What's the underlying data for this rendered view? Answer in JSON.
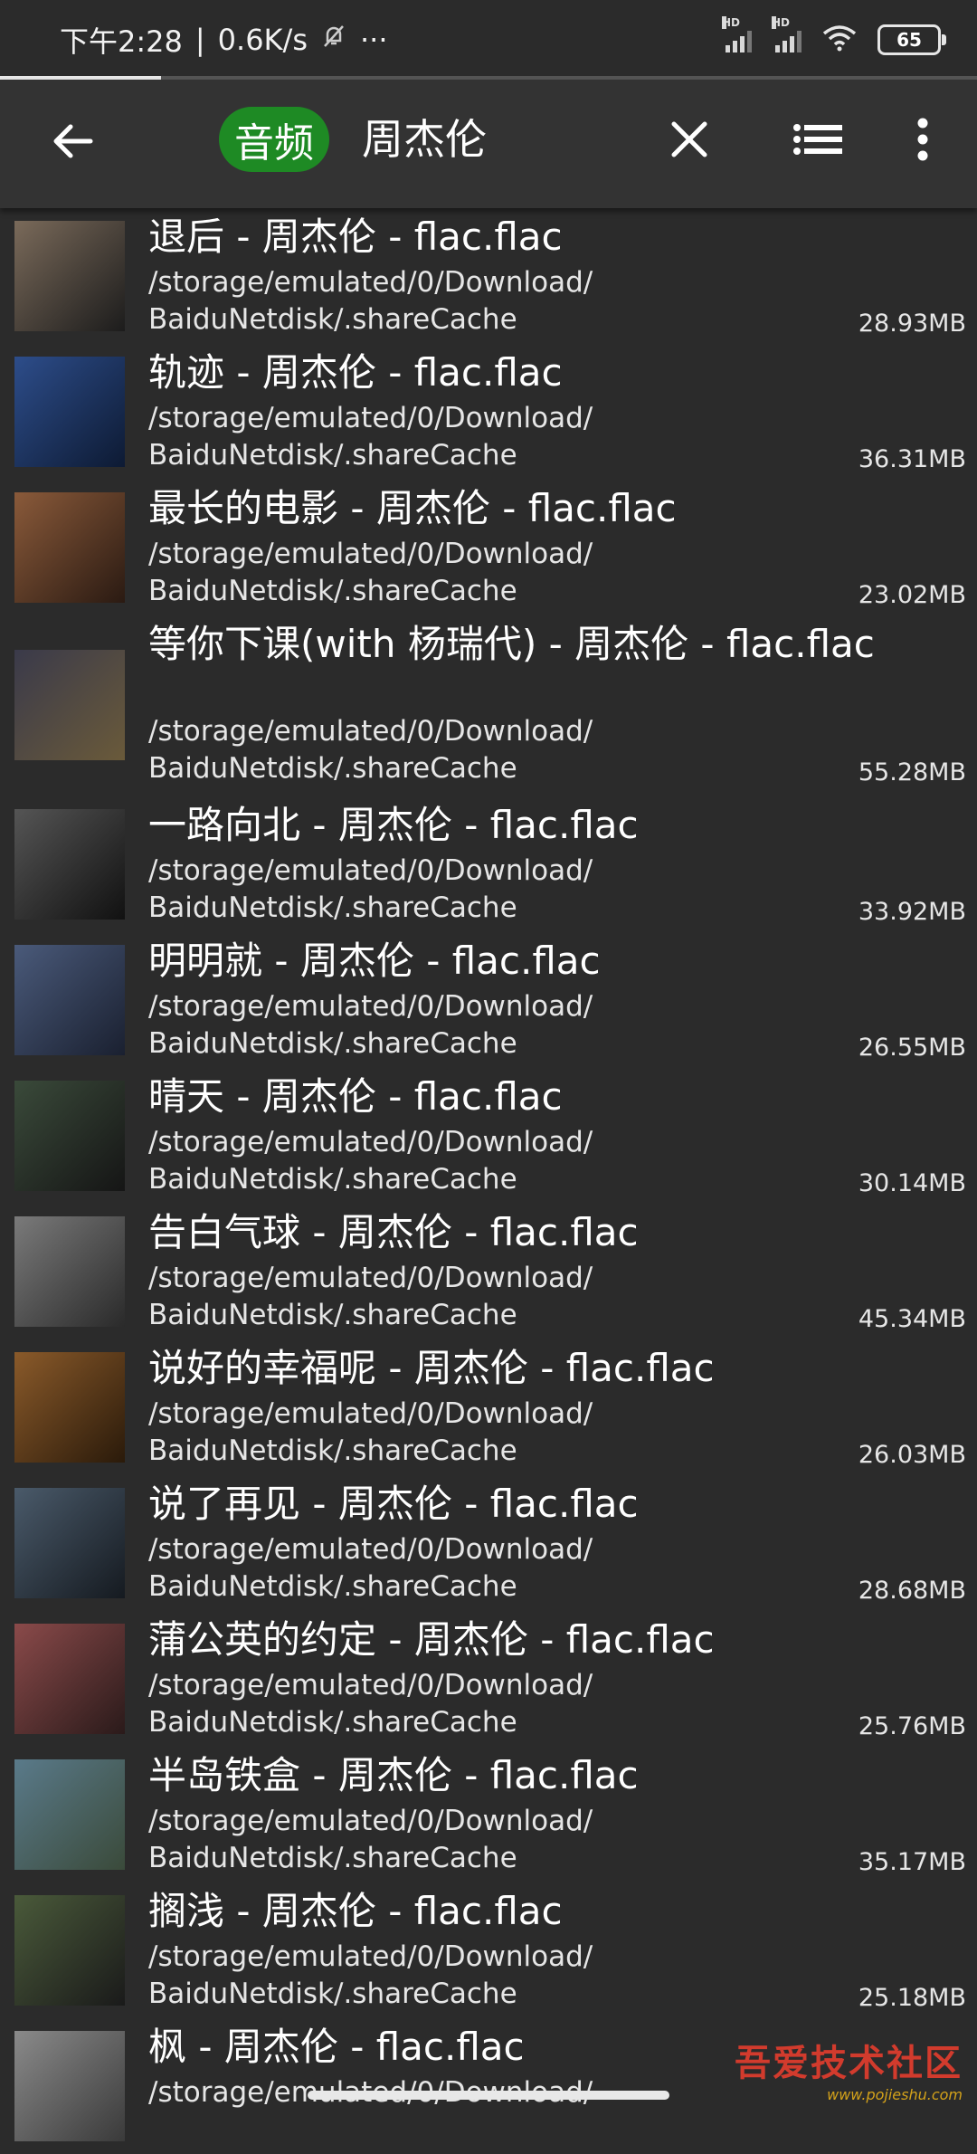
{
  "status_bar": {
    "time": "下午2:28",
    "separator": "|",
    "net_speed": "0.6K/s",
    "dnd_icon": "mute-bell-icon",
    "more_dots": "···",
    "signal1_label": "HD",
    "signal2_label": "HD",
    "wifi_icon": "wifi-icon",
    "battery": "65"
  },
  "progress": 0.165,
  "app_bar": {
    "back_icon": "arrow-left-icon",
    "filter_chip": "音频",
    "query": "周杰伦",
    "clear_icon": "close-icon",
    "view_icon": "list-view-icon",
    "more_icon": "more-vertical-icon"
  },
  "files": [
    {
      "title": "退后 - 周杰伦 - flac.flac",
      "path1": "/storage/emulated/0/Download/",
      "path2": "BaiduNetdisk/.shareCache",
      "size": "28.93MB"
    },
    {
      "title": "轨迹 - 周杰伦 - flac.flac",
      "path1": "/storage/emulated/0/Download/",
      "path2": "BaiduNetdisk/.shareCache",
      "size": "36.31MB"
    },
    {
      "title": "最长的电影 - 周杰伦 - flac.flac",
      "path1": "/storage/emulated/0/Download/",
      "path2": "BaiduNetdisk/.shareCache",
      "size": "23.02MB"
    },
    {
      "title": "等你下课(with 杨瑞代) - 周杰伦 - flac.flac",
      "path1": "/storage/emulated/0/Download/",
      "path2": "BaiduNetdisk/.shareCache",
      "size": "55.28MB"
    },
    {
      "title": "一路向北 - 周杰伦 - flac.flac",
      "path1": "/storage/emulated/0/Download/",
      "path2": "BaiduNetdisk/.shareCache",
      "size": "33.92MB"
    },
    {
      "title": "明明就 - 周杰伦 - flac.flac",
      "path1": "/storage/emulated/0/Download/",
      "path2": "BaiduNetdisk/.shareCache",
      "size": "26.55MB"
    },
    {
      "title": "晴天 - 周杰伦 - flac.flac",
      "path1": "/storage/emulated/0/Download/",
      "path2": "BaiduNetdisk/.shareCache",
      "size": "30.14MB"
    },
    {
      "title": "告白气球 - 周杰伦 - flac.flac",
      "path1": "/storage/emulated/0/Download/",
      "path2": "BaiduNetdisk/.shareCache",
      "size": "45.34MB"
    },
    {
      "title": "说好的幸福呢 - 周杰伦 - flac.flac",
      "path1": "/storage/emulated/0/Download/",
      "path2": "BaiduNetdisk/.shareCache",
      "size": "26.03MB"
    },
    {
      "title": "说了再见 - 周杰伦 - flac.flac",
      "path1": "/storage/emulated/0/Download/",
      "path2": "BaiduNetdisk/.shareCache",
      "size": "28.68MB"
    },
    {
      "title": "蒲公英的约定 - 周杰伦 - flac.flac",
      "path1": "/storage/emulated/0/Download/",
      "path2": "BaiduNetdisk/.shareCache",
      "size": "25.76MB"
    },
    {
      "title": "半岛铁盒 - 周杰伦 - flac.flac",
      "path1": "/storage/emulated/0/Download/",
      "path2": "BaiduNetdisk/.shareCache",
      "size": "35.17MB"
    },
    {
      "title": "搁浅 - 周杰伦 - flac.flac",
      "path1": "/storage/emulated/0/Download/",
      "path2": "BaiduNetdisk/.shareCache",
      "size": "25.18MB"
    },
    {
      "title": "枫 - 周杰伦 - flac.flac",
      "path1": "/storage/emulated/0/Download/",
      "path2": "",
      "size": ""
    }
  ],
  "watermark": {
    "main": "吾爱技术社区",
    "sub": "www.pojieshu.com"
  },
  "colors": {
    "background": "#2b2b2b",
    "app_bar": "#333333",
    "chip": "#1e8a24",
    "watermark": "#d23b2d"
  }
}
